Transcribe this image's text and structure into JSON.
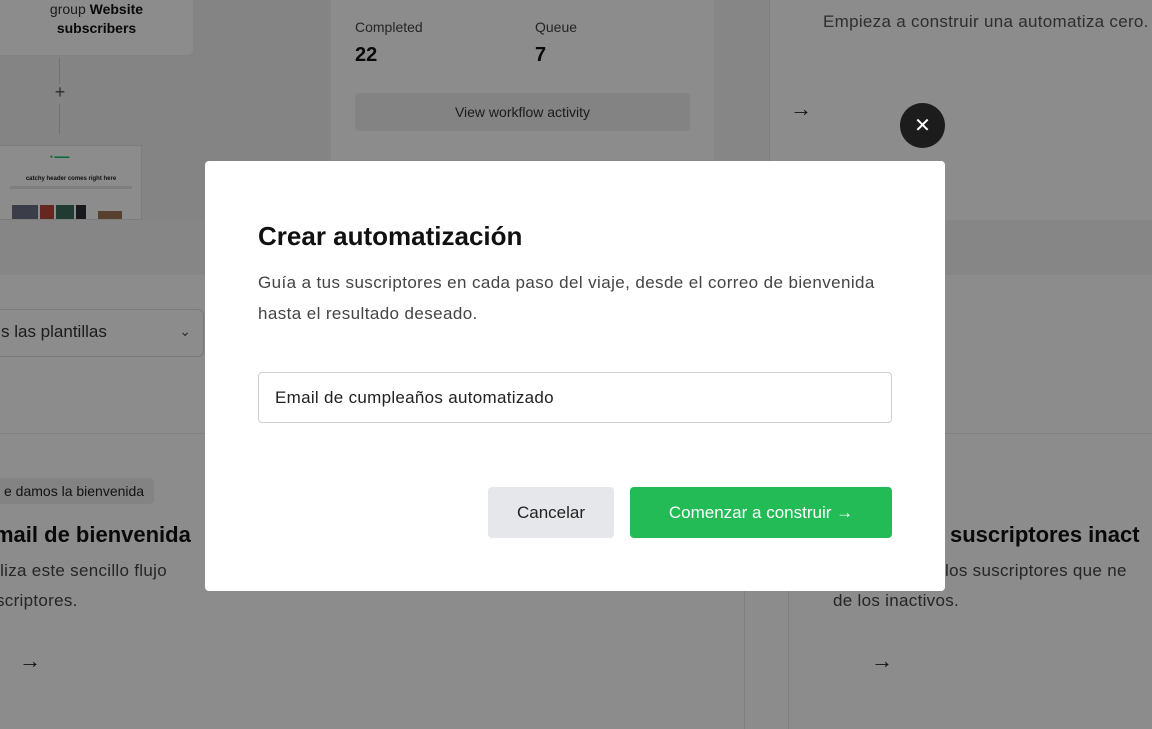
{
  "background": {
    "trigger_card": {
      "line1": "group ",
      "line1_bold": "Website",
      "line2": "subscribers"
    },
    "email_preview": {
      "header": "catchy header comes right here"
    },
    "stats": {
      "completed_label": "Completed",
      "completed_value": "22",
      "queue_label": "Queue",
      "queue_value": "7",
      "activity_button": "View workflow activity"
    },
    "scratch_card": {
      "text": "Empieza a construir una automatiza cero."
    },
    "template_filter": {
      "selected": "s las plantillas"
    },
    "templates": [
      {
        "badge": "e damos la bienvenida",
        "title": "mail de bienvenida",
        "desc_line1": "iliza este sencillo flujo",
        "desc_line2": "scriptores."
      },
      {
        "title": "suscriptores inact",
        "desc_line1": "los suscriptores que ne",
        "desc_line2": "de los inactivos."
      }
    ]
  },
  "modal": {
    "title": "Crear automatización",
    "description": "Guía a tus suscriptores en cada paso del viaje, desde el correo de bienvenida hasta el resultado deseado.",
    "input_value": "Email de cumpleaños automatizado",
    "cancel_label": "Cancelar",
    "start_label": "Comenzar a construir →"
  },
  "icons": {
    "close": "close-icon",
    "arrow": "arrow-right-icon",
    "plus": "plus-icon",
    "chevron": "chevron-down-icon"
  },
  "colors": {
    "primary": "#22bb55",
    "overlay": "rgba(0,0,0,0.45)"
  }
}
